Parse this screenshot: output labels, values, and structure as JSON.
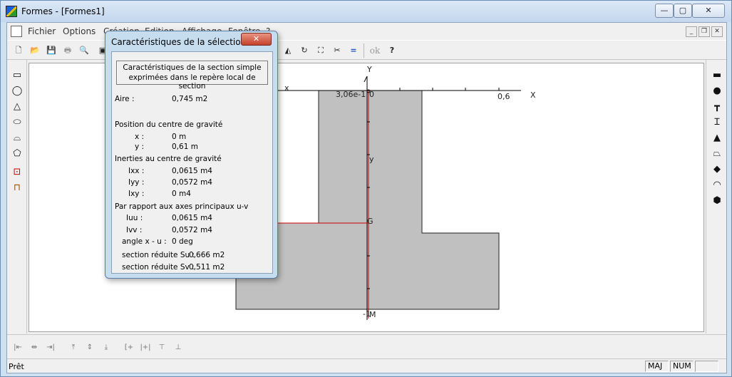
{
  "window": {
    "title": "Formes - [Formes1]",
    "minimize": "—",
    "maximize": "▢",
    "close": "✕"
  },
  "menu": {
    "items": [
      "Fichier",
      "Options",
      "Création",
      "Edition",
      "Affichage",
      "Fenêtre",
      "?"
    ],
    "mdi_min": "_",
    "mdi_restore": "❐",
    "mdi_close": "✕"
  },
  "toolbar": {
    "ok_label": "ok",
    "help_label": "?"
  },
  "canvas": {
    "x_axis": "X",
    "y_axis": "Y",
    "tick_x_left": "3,06e-1",
    "tick_x_zero": "0",
    "tick_x_right": "0,6",
    "y_label": "y",
    "g_label": "G",
    "x_left_label": "x",
    "tick_y_bottom": "-1",
    "m_label": "M"
  },
  "dialog": {
    "title": "Caractéristiques de la sélection",
    "close": "✕",
    "head_line1": "Caractéristiques de la section simple",
    "head_line2": "exprimées dans le repère local de section",
    "aire_label": "Aire :",
    "aire_value": "0,745  m2",
    "cg_title": "Position du centre de gravité",
    "x_label": "x :",
    "x_value": "0  m",
    "y_label": "y :",
    "y_value": "0,61  m",
    "inerties_title": "Inerties au centre de gravité",
    "ixx_label": "Ixx :",
    "ixx_value": "0,0615  m4",
    "iyy_label": "Iyy :",
    "iyy_value": "0,0572  m4",
    "ixy_label": "Ixy :",
    "ixy_value": "0  m4",
    "axes_title": "Par rapport aux axes principaux u-v",
    "iuu_label": "Iuu :",
    "iuu_value": "0,0615  m4",
    "ivv_label": "Ivv :",
    "ivv_value": "0,0572  m4",
    "angle_label": "angle x - u :",
    "angle_value": "0  deg",
    "su_label": "section réduite Su :",
    "su_value": "0,666  m2",
    "sv_label": "section réduite Sv :",
    "sv_value": "0,511  m2"
  },
  "status": {
    "text": "Prêt",
    "maj": "MAJ",
    "num": "NUM",
    "empty": ""
  },
  "colors": {
    "shape_fill": "#c0c0c0",
    "axis_red": "#cc0000"
  }
}
